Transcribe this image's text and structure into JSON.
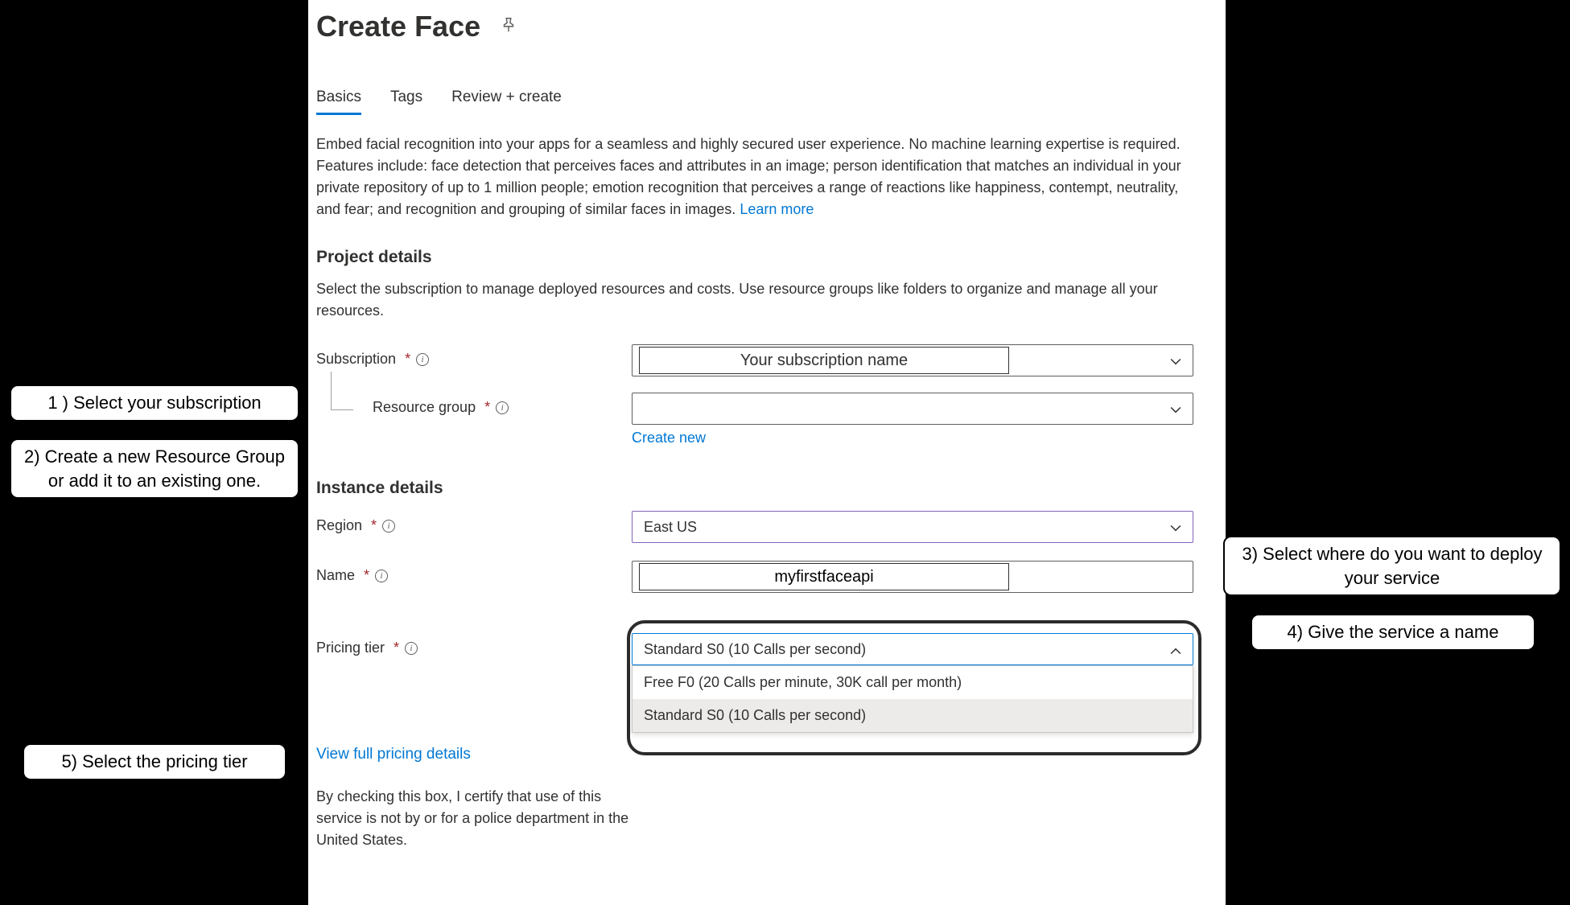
{
  "header": {
    "title": "Create Face"
  },
  "tabs": {
    "basics": "Basics",
    "tags": "Tags",
    "review": "Review + create"
  },
  "intro": {
    "text": "Embed facial recognition into your apps for a seamless and highly secured user experience. No machine learning expertise is required. Features include: face detection that perceives faces and attributes in an image; person identification that matches an individual in your private repository of up to 1 million people; emotion recognition that perceives a range of reactions like happiness, contempt, neutrality, and fear; and recognition and grouping of similar faces in images. ",
    "learn_more": "Learn more"
  },
  "project": {
    "title": "Project details",
    "desc": "Select the subscription to manage deployed resources and costs. Use resource groups like folders to organize and manage all your resources.",
    "subscription_label": "Subscription",
    "subscription_value": "Your subscription name",
    "rg_label": "Resource group",
    "create_new": "Create new"
  },
  "instance": {
    "title": "Instance details",
    "region_label": "Region",
    "region_value": "East US",
    "name_label": "Name",
    "name_value": "myfirstfaceapi"
  },
  "pricing": {
    "label": "Pricing tier",
    "selected": "Standard S0 (10 Calls per second)",
    "option_free": "Free F0 (20 Calls per minute, 30K call per month)",
    "option_standard": "Standard S0 (10 Calls per second)",
    "link": "View full pricing details"
  },
  "cert": {
    "text": "By checking this box, I certify that use of this service is not by or for a police department in the United States."
  },
  "callouts": {
    "c1": "1 ) Select your subscription",
    "c2": "2) Create a new Resource Group or add it to an existing one.",
    "c3": "3) Select where do you want to deploy your service",
    "c4": "4) Give the service a name",
    "c5": "5) Select the pricing tier"
  }
}
